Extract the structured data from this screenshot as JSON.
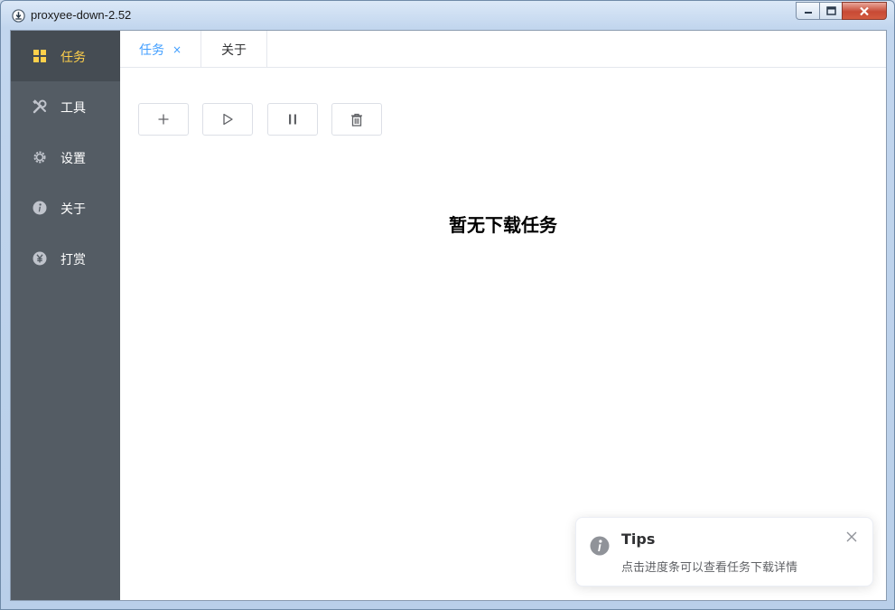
{
  "window": {
    "title": "proxyee-down-2.52"
  },
  "sidebar": {
    "items": [
      {
        "label": "任务",
        "icon": "grid-icon",
        "active": true
      },
      {
        "label": "工具",
        "icon": "tools-icon",
        "active": false
      },
      {
        "label": "设置",
        "icon": "gear-icon",
        "active": false
      },
      {
        "label": "关于",
        "icon": "info-icon",
        "active": false
      },
      {
        "label": "打赏",
        "icon": "yen-icon",
        "active": false
      }
    ]
  },
  "tabs": [
    {
      "label": "任务",
      "closable": true,
      "close_glyph": "×",
      "active": true
    },
    {
      "label": "关于",
      "closable": false,
      "active": false
    }
  ],
  "toolbar": {
    "buttons": [
      {
        "name": "add",
        "icon": "plus-icon"
      },
      {
        "name": "start",
        "icon": "play-icon"
      },
      {
        "name": "pause",
        "icon": "pause-icon"
      },
      {
        "name": "delete",
        "icon": "trash-icon"
      }
    ]
  },
  "main": {
    "empty_text": "暂无下载任务"
  },
  "notification": {
    "title": "Tips",
    "message": "点击进度条可以查看任务下载详情",
    "icon": "info-icon"
  },
  "colors": {
    "sidebar_bg": "#545c64",
    "sidebar_active_bg": "#454c53",
    "sidebar_active_text": "#ffd04b",
    "tab_active": "#409eff"
  }
}
